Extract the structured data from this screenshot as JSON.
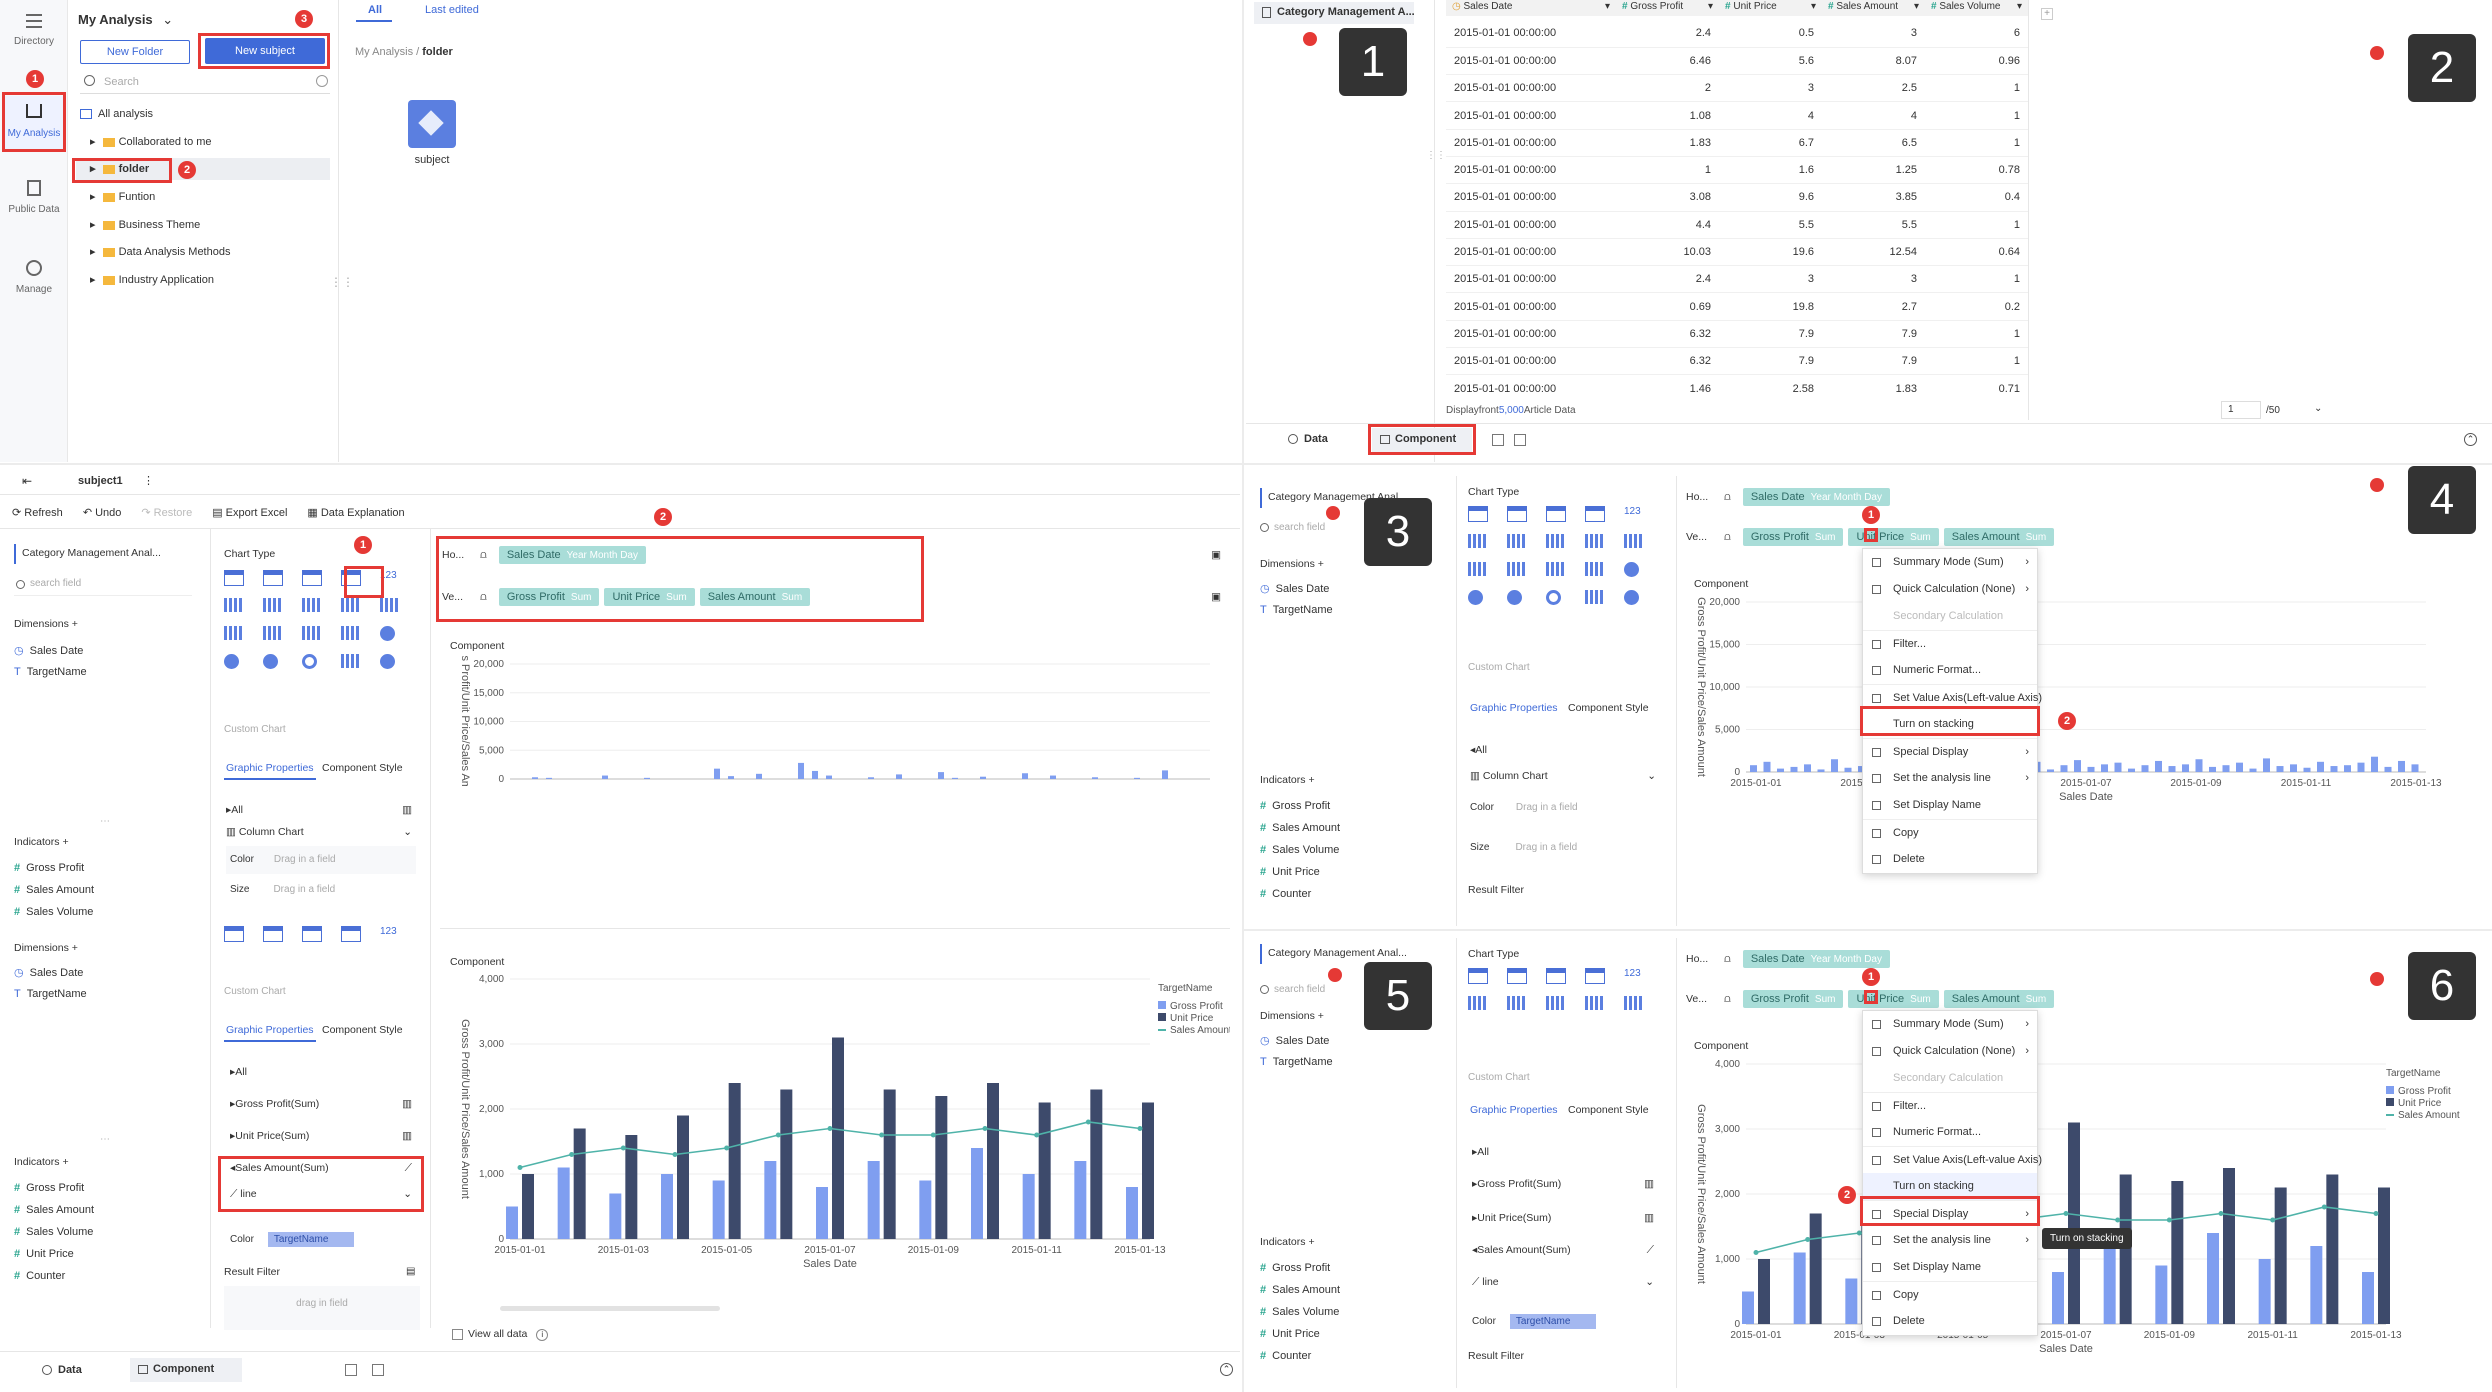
{
  "p1": {
    "nav": [
      {
        "label": "Directory",
        "icon": "directory-icon"
      },
      {
        "label": "My Analysis",
        "icon": "my-analysis-icon"
      },
      {
        "label": "Public Data",
        "icon": "public-data-icon"
      },
      {
        "label": "Manage",
        "icon": "manage-icon"
      }
    ],
    "title": "My Analysis",
    "new_folder": "New Folder",
    "new_subject": "New subject",
    "search_placeholder": "Search",
    "tree": [
      "All analysis",
      "Collaborated to me",
      "folder",
      "Funtion",
      "Business Theme",
      "Data Analysis Methods",
      "Industry Application"
    ],
    "tabs": [
      "All",
      "Last edited"
    ],
    "breadcrumb": [
      "My Analysis",
      "folder"
    ],
    "file_label": "subject"
  },
  "p2": {
    "dataset": "Category Management A...",
    "columns": [
      "Sales Date",
      "Gross Profit",
      "Unit Price",
      "Sales Amount",
      "Sales Volume"
    ],
    "rows": [
      [
        "2015-01-01 00:00:00",
        "2.4",
        "0.5",
        "3",
        "6"
      ],
      [
        "2015-01-01 00:00:00",
        "6.46",
        "5.6",
        "8.07",
        "0.96"
      ],
      [
        "2015-01-01 00:00:00",
        "2",
        "3",
        "2.5",
        "1"
      ],
      [
        "2015-01-01 00:00:00",
        "1.08",
        "4",
        "4",
        "1"
      ],
      [
        "2015-01-01 00:00:00",
        "1.83",
        "6.7",
        "6.5",
        "1"
      ],
      [
        "2015-01-01 00:00:00",
        "1",
        "1.6",
        "1.25",
        "0.78"
      ],
      [
        "2015-01-01 00:00:00",
        "3.08",
        "9.6",
        "3.85",
        "0.4"
      ],
      [
        "2015-01-01 00:00:00",
        "4.4",
        "5.5",
        "5.5",
        "1"
      ],
      [
        "2015-01-01 00:00:00",
        "10.03",
        "19.6",
        "12.54",
        "0.64"
      ],
      [
        "2015-01-01 00:00:00",
        "2.4",
        "3",
        "3",
        "1"
      ],
      [
        "2015-01-01 00:00:00",
        "0.69",
        "19.8",
        "2.7",
        "0.2"
      ],
      [
        "2015-01-01 00:00:00",
        "6.32",
        "7.9",
        "7.9",
        "1"
      ],
      [
        "2015-01-01 00:00:00",
        "6.32",
        "7.9",
        "7.9",
        "1"
      ],
      [
        "2015-01-01 00:00:00",
        "1.46",
        "2.58",
        "1.83",
        "0.71"
      ]
    ],
    "footer_prefix": "Displayfront",
    "footer_count": "5,000",
    "footer_suffix": "Article Data",
    "page": "1",
    "pages": "/50",
    "tab_data": "Data",
    "tab_component": "Component"
  },
  "p3": {
    "subject": "subject1",
    "toolbar": [
      "Refresh",
      "Undo",
      "Restore",
      "Export Excel",
      "Data Explanation"
    ],
    "dataset": "Category Management Anal...",
    "search_placeholder": "search field",
    "dimensions_label": "Dimensions",
    "dimensions": [
      "Sales Date",
      "TargetName"
    ],
    "indicators_label": "Indicators",
    "indicators": [
      "Gross Profit",
      "Sales Amount",
      "Sales Volume",
      "Unit Price",
      "Counter"
    ],
    "chart_type": "Chart Type",
    "custom_chart": "Custom Chart",
    "graphic_properties": "Graphic Properties",
    "component_style": "Component Style",
    "all": "All",
    "column_chart": "Column Chart",
    "color": "Color",
    "drag_field": "Drag in a field",
    "size": "Size",
    "series_props": [
      "Gross Profit(Sum)",
      "Unit Price(Sum)",
      "Sales Amount(Sum)"
    ],
    "line": "line",
    "color_chip": "TargetName",
    "result_filter": "Result Filter",
    "drag_in_field": "drag in field",
    "ho": "Ho...",
    "ve": "Ve...",
    "x_chip": "Sales Date",
    "x_chip_sub": "Year Month Day",
    "y_chips": [
      {
        "label": "Gross Profit",
        "sub": "Sum"
      },
      {
        "label": "Unit Price",
        "sub": "Sum"
      },
      {
        "label": "Sales Amount",
        "sub": "Sum"
      }
    ],
    "component": "Component",
    "view_all": "View all data",
    "tab_data": "Data",
    "tab_component": "Component",
    "counter_label": "123"
  },
  "menu": {
    "items": [
      "Summary Mode (Sum)",
      "Quick Calculation (None)",
      "Secondary Calculation",
      "Filter...",
      "Numeric Format...",
      "Set Value Axis(Left-value Axis)",
      "Turn on stacking",
      "Special Display",
      "Set the analysis line",
      "Set Display Name",
      "Copy",
      "Delete"
    ],
    "tooltip": "Turn on stacking"
  },
  "steps": [
    "1",
    "2",
    "3",
    "4",
    "5",
    "6"
  ],
  "colors": {
    "accent": "#3f6ad8",
    "red": "#e53935",
    "bar_light": "#7f9ef0",
    "bar_dark": "#3d4a6b",
    "line": "#4fb3a9",
    "chip": "#a9ddd8"
  },
  "chart_data": [
    {
      "type": "bar",
      "title": "Component",
      "ylabel": "Gross Profit/Unit Price/Sales Amount",
      "ylim": [
        0,
        20000
      ],
      "yticks": [
        0,
        5000,
        10000,
        15000,
        20000
      ],
      "note": "preview, sparse small bars"
    },
    {
      "type": "bar",
      "title": "Component",
      "xlabel": "Sales Date",
      "ylabel": "Gross Profit/Unit Price/Sales Amount",
      "ylim": [
        0,
        4000
      ],
      "yticks": [
        0,
        1000,
        2000,
        3000,
        4000
      ],
      "legend_title": "TargetName",
      "legend": "top-right",
      "categories": [
        "2015-01-01",
        "2015-01-02",
        "2015-01-03",
        "2015-01-04",
        "2015-01-05",
        "2015-01-06",
        "2015-01-07",
        "2015-01-08",
        "2015-01-09",
        "2015-01-10",
        "2015-01-11",
        "2015-01-12",
        "2015-01-13"
      ],
      "xticks": [
        "2015-01-01",
        "2015-01-03",
        "2015-01-05",
        "2015-01-07",
        "2015-01-09",
        "2015-01-11",
        "2015-01-13"
      ],
      "series": [
        {
          "name": "Gross Profit",
          "type": "bar",
          "values": [
            1000,
            1700,
            1600,
            1900,
            2400,
            2300,
            3100,
            2300,
            2200,
            2400,
            2100,
            2300,
            2100
          ]
        },
        {
          "name": "Unit Price",
          "type": "bar",
          "values": [
            500,
            1100,
            700,
            1000,
            900,
            1200,
            800,
            1200,
            900,
            1400,
            1000,
            1200,
            800
          ]
        },
        {
          "name": "Sales Amount",
          "type": "line",
          "values": [
            1100,
            1300,
            1400,
            1300,
            1400,
            1600,
            1700,
            1600,
            1600,
            1700,
            1600,
            1800,
            1700
          ]
        }
      ]
    },
    {
      "type": "bar",
      "title": "Component",
      "xlabel": "Sales Date",
      "ylabel": "Gross Profit/Unit Price/Sales Amount",
      "ylim": [
        0,
        20000
      ],
      "yticks": [
        0,
        5000,
        10000,
        15000,
        20000
      ],
      "xticks": [
        "2015-01-01",
        "2015-01-03",
        "2015-01-05",
        "2015-01-07",
        "2015-01-09",
        "2015-01-11",
        "2015-01-13"
      ]
    },
    {
      "type": "bar",
      "title": "Component",
      "xlabel": "Sales Date",
      "ylabel": "Gross Profit/Unit Price/Sales Amount",
      "ylim": [
        0,
        4000
      ],
      "yticks": [
        0,
        1000,
        2000,
        3000,
        4000
      ],
      "legend_title": "TargetName",
      "legend": "top-right",
      "xticks": [
        "2015-01-01",
        "2015-01-03",
        "2015-01-05",
        "2015-01-07",
        "2015-01-09",
        "2015-01-11",
        "2015-01-13"
      ]
    }
  ]
}
